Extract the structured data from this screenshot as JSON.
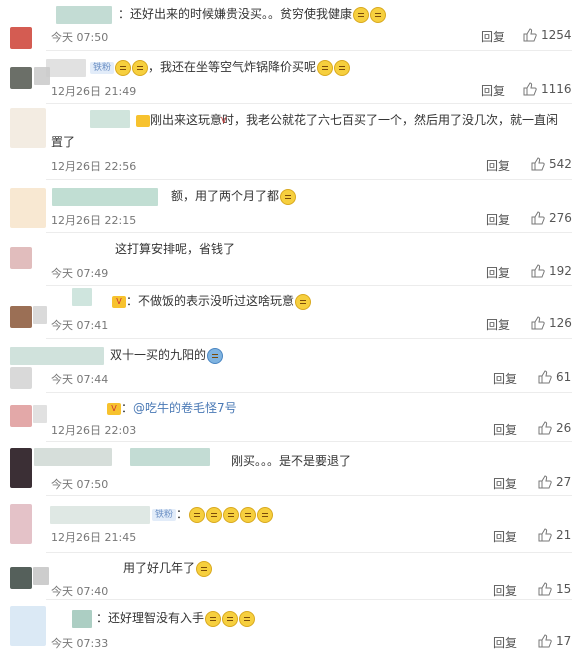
{
  "comments": [
    {
      "text": "：还好出来的时候嫌贵没买。。贫穷使我健康",
      "time": "今天 07:50",
      "reply": "回复",
      "likes": "1254"
    },
    {
      "badge": "铁粉",
      "text": "我还在坐等空气炸锅降价买呢",
      "time": "12月26日 21:49",
      "reply": "回复",
      "likes": "1116"
    },
    {
      "text": "刚出来这玩意时，我老公就花了六七百买了一个，然后用了没几次，就一直闲置了",
      "time": "12月26日 22:56",
      "reply": "回复",
      "likes": "542"
    },
    {
      "text": "额，用了两个月了都",
      "time": "12月26日 22:15",
      "reply": "回复",
      "likes": "276"
    },
    {
      "text": "这打算安排呢，省钱了",
      "time": "今天 07:49",
      "reply": "回复",
      "likes": "192"
    },
    {
      "text": "：不做饭的表示没听过这啥玩意",
      "time": "今天 07:41",
      "reply": "回复",
      "likes": "126"
    },
    {
      "text": "双十一买的九阳的",
      "time": "今天 07:44",
      "reply": "回复",
      "likes": "61"
    },
    {
      "text": "@吃牛的卷毛怪7号",
      "time": "12月26日 22:03",
      "reply": "回复",
      "likes": "26"
    },
    {
      "text": "刚买。。。是不是要退了",
      "time": "今天 07:50",
      "reply": "回复",
      "likes": "27"
    },
    {
      "badge": "铁粉",
      "text": "",
      "time": "12月26日 21:45",
      "reply": "回复",
      "likes": "21"
    },
    {
      "text": "用了好几年了",
      "time": "今天 07:40",
      "reply": "回复",
      "likes": "15"
    },
    {
      "text": "：还好理智没有入手",
      "time": "今天 07:33",
      "reply": "回复",
      "likes": "17"
    }
  ]
}
